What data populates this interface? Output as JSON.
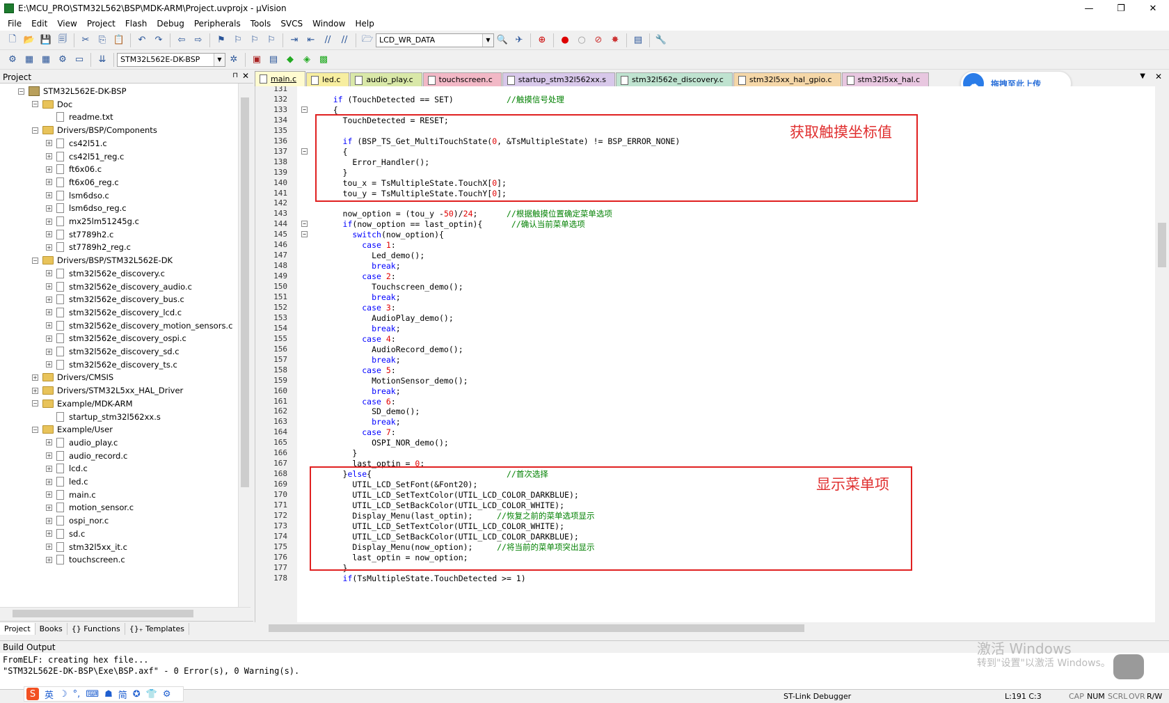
{
  "window": {
    "title": "E:\\MCU_PRO\\STM32L562\\BSP\\MDK-ARM\\Project.uvprojx - µVision",
    "minimize": "—",
    "restore": "❐",
    "close": "✕"
  },
  "menu": [
    "File",
    "Edit",
    "View",
    "Project",
    "Flash",
    "Debug",
    "Peripherals",
    "Tools",
    "SVCS",
    "Window",
    "Help"
  ],
  "toolbar": {
    "find_combo": "LCD_WR_DATA",
    "target_combo": "STM32L562E-DK-BSP"
  },
  "project_panel": {
    "title": "Project",
    "pin": "⊓",
    "close": "✕",
    "tree": [
      {
        "label": "STM32L562E-DK-BSP",
        "level": 0,
        "type": "project",
        "expand": "−"
      },
      {
        "label": "Doc",
        "level": 1,
        "type": "folder",
        "expand": "−"
      },
      {
        "label": "readme.txt",
        "level": 2,
        "type": "file",
        "expand": ""
      },
      {
        "label": "Drivers/BSP/Components",
        "level": 1,
        "type": "folder",
        "expand": "−"
      },
      {
        "label": "cs42l51.c",
        "level": 2,
        "type": "file",
        "expand": "+"
      },
      {
        "label": "cs42l51_reg.c",
        "level": 2,
        "type": "file",
        "expand": "+"
      },
      {
        "label": "ft6x06.c",
        "level": 2,
        "type": "file",
        "expand": "+"
      },
      {
        "label": "ft6x06_reg.c",
        "level": 2,
        "type": "file",
        "expand": "+"
      },
      {
        "label": "lsm6dso.c",
        "level": 2,
        "type": "file",
        "expand": "+"
      },
      {
        "label": "lsm6dso_reg.c",
        "level": 2,
        "type": "file",
        "expand": "+"
      },
      {
        "label": "mx25lm51245g.c",
        "level": 2,
        "type": "file",
        "expand": "+"
      },
      {
        "label": "st7789h2.c",
        "level": 2,
        "type": "file",
        "expand": "+"
      },
      {
        "label": "st7789h2_reg.c",
        "level": 2,
        "type": "file",
        "expand": "+"
      },
      {
        "label": "Drivers/BSP/STM32L562E-DK",
        "level": 1,
        "type": "folder",
        "expand": "−"
      },
      {
        "label": "stm32l562e_discovery.c",
        "level": 2,
        "type": "file",
        "expand": "+"
      },
      {
        "label": "stm32l562e_discovery_audio.c",
        "level": 2,
        "type": "file",
        "expand": "+"
      },
      {
        "label": "stm32l562e_discovery_bus.c",
        "level": 2,
        "type": "file",
        "expand": "+"
      },
      {
        "label": "stm32l562e_discovery_lcd.c",
        "level": 2,
        "type": "file",
        "expand": "+"
      },
      {
        "label": "stm32l562e_discovery_motion_sensors.c",
        "level": 2,
        "type": "file",
        "expand": "+"
      },
      {
        "label": "stm32l562e_discovery_ospi.c",
        "level": 2,
        "type": "file",
        "expand": "+"
      },
      {
        "label": "stm32l562e_discovery_sd.c",
        "level": 2,
        "type": "file",
        "expand": "+"
      },
      {
        "label": "stm32l562e_discovery_ts.c",
        "level": 2,
        "type": "file",
        "expand": "+"
      },
      {
        "label": "Drivers/CMSIS",
        "level": 1,
        "type": "folder",
        "expand": "+"
      },
      {
        "label": "Drivers/STM32L5xx_HAL_Driver",
        "level": 1,
        "type": "folder",
        "expand": "+"
      },
      {
        "label": "Example/MDK-ARM",
        "level": 1,
        "type": "folder",
        "expand": "−"
      },
      {
        "label": "startup_stm32l562xx.s",
        "level": 2,
        "type": "file",
        "expand": ""
      },
      {
        "label": "Example/User",
        "level": 1,
        "type": "folder",
        "expand": "−"
      },
      {
        "label": "audio_play.c",
        "level": 2,
        "type": "file",
        "expand": "+"
      },
      {
        "label": "audio_record.c",
        "level": 2,
        "type": "file",
        "expand": "+"
      },
      {
        "label": "lcd.c",
        "level": 2,
        "type": "file",
        "expand": "+"
      },
      {
        "label": "led.c",
        "level": 2,
        "type": "file",
        "expand": "+"
      },
      {
        "label": "main.c",
        "level": 2,
        "type": "file",
        "expand": "+"
      },
      {
        "label": "motion_sensor.c",
        "level": 2,
        "type": "file",
        "expand": "+"
      },
      {
        "label": "ospi_nor.c",
        "level": 2,
        "type": "file",
        "expand": "+"
      },
      {
        "label": "sd.c",
        "level": 2,
        "type": "file",
        "expand": "+"
      },
      {
        "label": "stm32l5xx_it.c",
        "level": 2,
        "type": "file",
        "expand": "+"
      },
      {
        "label": "touchscreen.c",
        "level": 2,
        "type": "file",
        "expand": "+"
      }
    ],
    "tabs": [
      "Project",
      "Books",
      "{} Functions",
      "{}₊ Templates"
    ]
  },
  "editor_tabs": [
    {
      "label": "main.c",
      "color": "#fffbd0",
      "active": true
    },
    {
      "label": "led.c",
      "color": "#f7eea0"
    },
    {
      "label": "audio_play.c",
      "color": "#d9e8a8"
    },
    {
      "label": "touchscreen.c",
      "color": "#f2b8c6"
    },
    {
      "label": "startup_stm32l562xx.s",
      "color": "#d8c8ea"
    },
    {
      "label": "stm32l562e_discovery.c",
      "color": "#bfe3d0"
    },
    {
      "label": "stm32l5xx_hal_gpio.c",
      "color": "#f5d7a8"
    },
    {
      "label": "stm32l5xx_hal.c",
      "color": "#e8c7e0"
    }
  ],
  "baidu": {
    "icon": "☁",
    "label": "拖拽至此上传"
  },
  "annotations": {
    "box1": "获取触摸坐标值",
    "box2": "显示菜单项"
  },
  "code": [
    {
      "n": "131",
      "fold": "",
      "t": []
    },
    {
      "n": "132",
      "fold": "",
      "t": [
        [
          "    ",
          ""
        ],
        [
          "if",
          "kw"
        ],
        [
          " (TouchDetected == SET)           ",
          ""
        ],
        [
          "//触摸信号处理",
          "cmt"
        ]
      ]
    },
    {
      "n": "133",
      "fold": "−",
      "t": [
        [
          "    {",
          ""
        ]
      ]
    },
    {
      "n": "134",
      "fold": "",
      "t": [
        [
          "      TouchDetected = RESET;",
          ""
        ]
      ]
    },
    {
      "n": "135",
      "fold": "",
      "t": []
    },
    {
      "n": "136",
      "fold": "",
      "t": [
        [
          "      ",
          ""
        ],
        [
          "if",
          "kw"
        ],
        [
          " (BSP_TS_Get_MultiTouchState(",
          ""
        ],
        [
          "0",
          "num"
        ],
        [
          ", &TsMultipleState) != BSP_ERROR_NONE)",
          ""
        ]
      ]
    },
    {
      "n": "137",
      "fold": "−",
      "t": [
        [
          "      {",
          ""
        ]
      ]
    },
    {
      "n": "138",
      "fold": "",
      "t": [
        [
          "        Error_Handler();",
          ""
        ]
      ]
    },
    {
      "n": "139",
      "fold": "",
      "t": [
        [
          "      }",
          ""
        ]
      ]
    },
    {
      "n": "140",
      "fold": "",
      "t": [
        [
          "      tou_x = TsMultipleState.TouchX[",
          ""
        ],
        [
          "0",
          "num"
        ],
        [
          "];",
          ""
        ]
      ]
    },
    {
      "n": "141",
      "fold": "",
      "t": [
        [
          "      tou_y = TsMultipleState.TouchY[",
          ""
        ],
        [
          "0",
          "num"
        ],
        [
          "];",
          ""
        ]
      ]
    },
    {
      "n": "142",
      "fold": "",
      "t": []
    },
    {
      "n": "143",
      "fold": "",
      "t": [
        [
          "      now_option = (tou_y -",
          ""
        ],
        [
          "50",
          "num"
        ],
        [
          ")/",
          ""
        ],
        [
          "24",
          "num"
        ],
        [
          ";      ",
          ""
        ],
        [
          "//根据触摸位置确定菜单选项",
          "cmt"
        ]
      ]
    },
    {
      "n": "144",
      "fold": "−",
      "t": [
        [
          "      ",
          ""
        ],
        [
          "if",
          "kw"
        ],
        [
          "(now_option == last_optin){      ",
          ""
        ],
        [
          "//确认当前菜单选项",
          "cmt"
        ]
      ]
    },
    {
      "n": "145",
      "fold": "−",
      "t": [
        [
          "        ",
          ""
        ],
        [
          "switch",
          "kw"
        ],
        [
          "(now_option){",
          ""
        ]
      ]
    },
    {
      "n": "146",
      "fold": "",
      "t": [
        [
          "          ",
          ""
        ],
        [
          "case",
          "kw"
        ],
        [
          " ",
          ""
        ],
        [
          "1",
          "num"
        ],
        [
          ":",
          ""
        ]
      ]
    },
    {
      "n": "147",
      "fold": "",
      "t": [
        [
          "            Led_demo();",
          ""
        ]
      ]
    },
    {
      "n": "148",
      "fold": "",
      "t": [
        [
          "            ",
          ""
        ],
        [
          "break",
          "kw"
        ],
        [
          ";",
          ""
        ]
      ]
    },
    {
      "n": "149",
      "fold": "",
      "t": [
        [
          "          ",
          ""
        ],
        [
          "case",
          "kw"
        ],
        [
          " ",
          ""
        ],
        [
          "2",
          "num"
        ],
        [
          ":",
          ""
        ]
      ]
    },
    {
      "n": "150",
      "fold": "",
      "t": [
        [
          "            Touchscreen_demo();",
          ""
        ]
      ]
    },
    {
      "n": "151",
      "fold": "",
      "t": [
        [
          "            ",
          ""
        ],
        [
          "break",
          "kw"
        ],
        [
          ";",
          ""
        ]
      ]
    },
    {
      "n": "152",
      "fold": "",
      "t": [
        [
          "          ",
          ""
        ],
        [
          "case",
          "kw"
        ],
        [
          " ",
          ""
        ],
        [
          "3",
          "num"
        ],
        [
          ":",
          ""
        ]
      ]
    },
    {
      "n": "153",
      "fold": "",
      "t": [
        [
          "            AudioPlay_demo();",
          ""
        ]
      ]
    },
    {
      "n": "154",
      "fold": "",
      "t": [
        [
          "            ",
          ""
        ],
        [
          "break",
          "kw"
        ],
        [
          ";",
          ""
        ]
      ]
    },
    {
      "n": "155",
      "fold": "",
      "t": [
        [
          "          ",
          ""
        ],
        [
          "case",
          "kw"
        ],
        [
          " ",
          ""
        ],
        [
          "4",
          "num"
        ],
        [
          ":",
          ""
        ]
      ]
    },
    {
      "n": "156",
      "fold": "",
      "t": [
        [
          "            AudioRecord_demo();",
          ""
        ]
      ]
    },
    {
      "n": "157",
      "fold": "",
      "t": [
        [
          "            ",
          ""
        ],
        [
          "break",
          "kw"
        ],
        [
          ";",
          ""
        ]
      ]
    },
    {
      "n": "158",
      "fold": "",
      "t": [
        [
          "          ",
          ""
        ],
        [
          "case",
          "kw"
        ],
        [
          " ",
          ""
        ],
        [
          "5",
          "num"
        ],
        [
          ":",
          ""
        ]
      ]
    },
    {
      "n": "159",
      "fold": "",
      "t": [
        [
          "            MotionSensor_demo();",
          ""
        ]
      ]
    },
    {
      "n": "160",
      "fold": "",
      "t": [
        [
          "            ",
          ""
        ],
        [
          "break",
          "kw"
        ],
        [
          ";",
          ""
        ]
      ]
    },
    {
      "n": "161",
      "fold": "",
      "t": [
        [
          "          ",
          ""
        ],
        [
          "case",
          "kw"
        ],
        [
          " ",
          ""
        ],
        [
          "6",
          "num"
        ],
        [
          ":",
          ""
        ]
      ]
    },
    {
      "n": "162",
      "fold": "",
      "t": [
        [
          "            SD_demo();",
          ""
        ]
      ]
    },
    {
      "n": "163",
      "fold": "",
      "t": [
        [
          "            ",
          ""
        ],
        [
          "break",
          "kw"
        ],
        [
          ";",
          ""
        ]
      ]
    },
    {
      "n": "164",
      "fold": "",
      "t": [
        [
          "          ",
          ""
        ],
        [
          "case",
          "kw"
        ],
        [
          " ",
          ""
        ],
        [
          "7",
          "num"
        ],
        [
          ":",
          ""
        ]
      ]
    },
    {
      "n": "165",
      "fold": "",
      "t": [
        [
          "            OSPI_NOR_demo();",
          ""
        ]
      ]
    },
    {
      "n": "166",
      "fold": "",
      "t": [
        [
          "        }",
          ""
        ]
      ]
    },
    {
      "n": "167",
      "fold": "",
      "t": [
        [
          "        last_optin = ",
          ""
        ],
        [
          "0",
          "num"
        ],
        [
          ";",
          ""
        ]
      ]
    },
    {
      "n": "168",
      "fold": "",
      "t": [
        [
          "      }",
          ""
        ],
        [
          "else",
          "kw"
        ],
        [
          "{                            ",
          ""
        ],
        [
          "//首次选择",
          "cmt"
        ]
      ]
    },
    {
      "n": "169",
      "fold": "",
      "t": [
        [
          "        UTIL_LCD_SetFont(&Font20);",
          ""
        ]
      ]
    },
    {
      "n": "170",
      "fold": "",
      "t": [
        [
          "        UTIL_LCD_SetTextColor(UTIL_LCD_COLOR_DARKBLUE);",
          ""
        ]
      ]
    },
    {
      "n": "171",
      "fold": "",
      "t": [
        [
          "        UTIL_LCD_SetBackColor(UTIL_LCD_COLOR_WHITE);",
          ""
        ]
      ]
    },
    {
      "n": "172",
      "fold": "",
      "t": [
        [
          "        Display_Menu(last_optin);     ",
          ""
        ],
        [
          "//恢复之前的菜单选项显示",
          "cmt"
        ]
      ]
    },
    {
      "n": "173",
      "fold": "",
      "t": [
        [
          "        UTIL_LCD_SetTextColor(UTIL_LCD_COLOR_WHITE);",
          ""
        ]
      ]
    },
    {
      "n": "174",
      "fold": "",
      "t": [
        [
          "        UTIL_LCD_SetBackColor(UTIL_LCD_COLOR_DARKBLUE);",
          ""
        ]
      ]
    },
    {
      "n": "175",
      "fold": "",
      "t": [
        [
          "        Display_Menu(now_option);     ",
          ""
        ],
        [
          "//将当前的菜单项突出显示",
          "cmt"
        ]
      ]
    },
    {
      "n": "176",
      "fold": "",
      "t": [
        [
          "        last_optin = now_option;",
          ""
        ]
      ]
    },
    {
      "n": "177",
      "fold": "",
      "t": [
        [
          "      }",
          ""
        ]
      ]
    },
    {
      "n": "178",
      "fold": "",
      "t": [
        [
          "      ",
          ""
        ],
        [
          "if",
          "kw"
        ],
        [
          "(TsMultipleState.TouchDetected >= 1)",
          ""
        ]
      ]
    }
  ],
  "build": {
    "title": "Build Output",
    "lines": "FromELF: creating hex file...\n\"STM32L562E-DK-BSP\\Exe\\BSP.axf\" - 0 Error(s), 0 Warning(s)."
  },
  "watermark": {
    "line1": "激活 Windows",
    "line2": "转到\"设置\"以激活 Windows。"
  },
  "status": {
    "debugger": "ST-Link Debugger",
    "position": "L:191 C:3",
    "cap": "CAP",
    "num": "NUM",
    "scrl": "SCRL",
    "ovr": "OVR",
    "rw": "R/W"
  },
  "ime": [
    "英",
    "☽",
    "°,",
    "⌨",
    "☗",
    "简",
    "✪",
    "👕",
    "⚙"
  ]
}
